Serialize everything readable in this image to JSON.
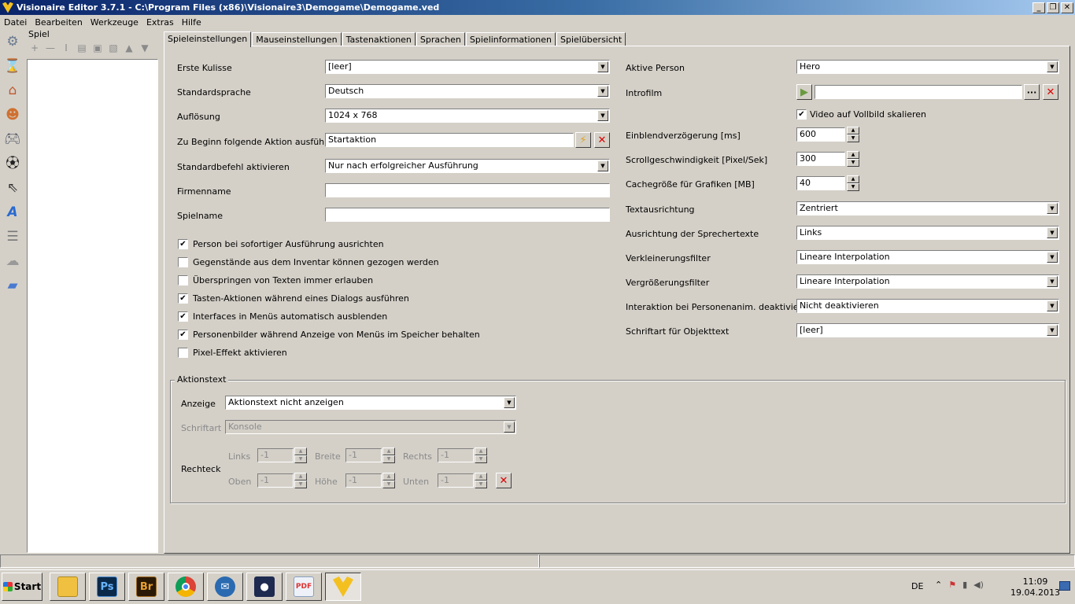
{
  "window": {
    "title": "Visionaire Editor 3.7.1 - C:\\Program Files (x86)\\Visionaire3\\Demogame\\Demogame.ved",
    "minimize": "_",
    "maximize": "❐",
    "close": "✕"
  },
  "menu": [
    "Datei",
    "Bearbeiten",
    "Werkzeuge",
    "Extras",
    "Hilfe"
  ],
  "tree": {
    "title": "Spiel"
  },
  "tabs": [
    "Spieleinstellungen",
    "Mauseinstellungen",
    "Tastenaktionen",
    "Sprachen",
    "Spielinformationen",
    "Spielübersicht"
  ],
  "left": {
    "erste_kulisse": {
      "label": "Erste Kulisse",
      "value": "[leer]"
    },
    "standardsprache": {
      "label": "Standardsprache",
      "value": "Deutsch"
    },
    "aufloesung": {
      "label": "Auflösung",
      "value": "1024 x 768"
    },
    "zu_beginn": {
      "label": "Zu Beginn folgende Aktion ausführen",
      "value": "Startaktion"
    },
    "standardbefehl": {
      "label": "Standardbefehl aktivieren",
      "value": "Nur nach erfolgreicher Ausführung"
    },
    "firmenname": {
      "label": "Firmenname",
      "value": ""
    },
    "spielname": {
      "label": "Spielname",
      "value": ""
    },
    "checkboxes": [
      {
        "label": "Person bei sofortiger Ausführung ausrichten",
        "mark": "✔"
      },
      {
        "label": "Gegenstände aus dem Inventar können gezogen werden",
        "mark": ""
      },
      {
        "label": "Überspringen von Texten immer erlauben",
        "mark": ""
      },
      {
        "label": "Tasten-Aktionen während eines Dialogs ausführen",
        "mark": "✔"
      },
      {
        "label": "Interfaces in Menüs automatisch ausblenden",
        "mark": "✔"
      },
      {
        "label": "Personenbilder während Anzeige von Menüs im Speicher behalten",
        "mark": "✔"
      },
      {
        "label": "Pixel-Effekt aktivieren",
        "mark": ""
      }
    ]
  },
  "right": {
    "aktive_person": {
      "label": "Aktive Person",
      "value": "Hero"
    },
    "introfilm": {
      "label": "Introfilm",
      "value": ""
    },
    "video_vollbild": {
      "label": "Video auf Vollbild skalieren",
      "mark": "✔"
    },
    "einblend": {
      "label": "Einblendverzögerung [ms]",
      "value": "600"
    },
    "scroll": {
      "label": "Scrollgeschwindigkeit [Pixel/Sek]",
      "value": "300"
    },
    "cache": {
      "label": "Cachegröße für Grafiken [MB]",
      "value": "40"
    },
    "textausrichtung": {
      "label": "Textausrichtung",
      "value": "Zentriert"
    },
    "sprechertexte": {
      "label": "Ausrichtung der Sprechertexte",
      "value": "Links"
    },
    "verkleinerung": {
      "label": "Verkleinerungsfilter",
      "value": "Lineare Interpolation"
    },
    "vergroesserung": {
      "label": "Vergrößerungsfilter",
      "value": "Lineare Interpolation"
    },
    "interaktion": {
      "label": "Interaktion bei Personenanim. deaktivieren",
      "value": "Nicht deaktivieren"
    },
    "schriftart_objekt": {
      "label": "Schriftart für Objekttext",
      "value": "[leer]"
    }
  },
  "aktionstext": {
    "title": "Aktionstext",
    "anzeige": {
      "label": "Anzeige",
      "value": "Aktionstext nicht anzeigen"
    },
    "schriftart": {
      "label": "Schriftart",
      "value": "Konsole"
    },
    "rechteck": {
      "label": "Rechteck"
    },
    "links": {
      "label": "Links",
      "value": "-1"
    },
    "breite": {
      "label": "Breite",
      "value": "-1"
    },
    "rechts": {
      "label": "Rechts",
      "value": "-1"
    },
    "oben": {
      "label": "Oben",
      "value": "-1"
    },
    "hoehe": {
      "label": "Höhe",
      "value": "-1"
    },
    "unten": {
      "label": "Unten",
      "value": "-1"
    }
  },
  "taskbar": {
    "start": "Start",
    "apps": [
      {
        "name": "file-explorer-icon",
        "glyph": "",
        "color": "#f0c040"
      },
      {
        "name": "photoshop-icon",
        "glyph": "Ps",
        "color": "#0b2a4a"
      },
      {
        "name": "bridge-icon",
        "glyph": "Br",
        "color": "#2a1a05"
      },
      {
        "name": "chrome-icon",
        "glyph": "",
        "color": "#db4437"
      },
      {
        "name": "thunderbird-icon",
        "glyph": "",
        "color": "#2a6ab0"
      },
      {
        "name": "user-account-icon",
        "glyph": "",
        "color": "#1e2a50"
      },
      {
        "name": "pdf-icon",
        "glyph": "PDF",
        "color": "#d33"
      },
      {
        "name": "visionaire-icon",
        "glyph": "",
        "color": "#f4c020"
      }
    ],
    "lang": "DE",
    "time": "11:09",
    "date": "19.04.2013"
  }
}
